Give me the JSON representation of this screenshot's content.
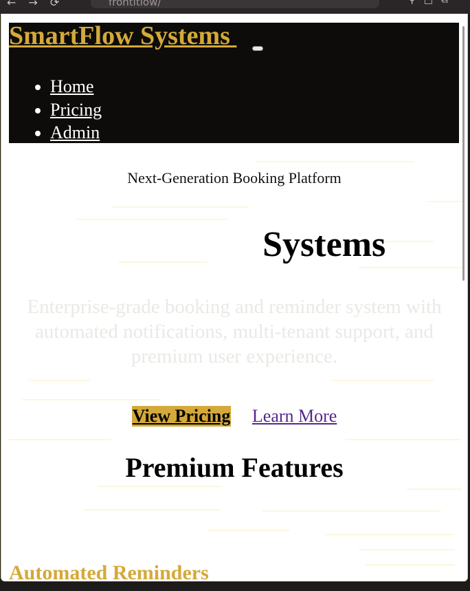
{
  "browser": {
    "url": "frontitlow/"
  },
  "header": {
    "brand": "SmartFlow Systems ",
    "nav": [
      "Home",
      "Pricing",
      "Admin"
    ]
  },
  "hero": {
    "tagline": "Next-Generation Booking Platform",
    "title_visible": "Systems",
    "subtitle": "Enterprise-grade booking and reminder system with automated notifications, multi-tenant support, and premium user experience."
  },
  "actions": {
    "primary": "View Pricing",
    "secondary": "Learn More"
  },
  "features": {
    "heading": "Premium Features",
    "first_feature": "Automated Reminders"
  },
  "colors": {
    "gold": "#d4a93a",
    "header_bg": "#0d0c0a",
    "link_purple": "#55288c"
  }
}
